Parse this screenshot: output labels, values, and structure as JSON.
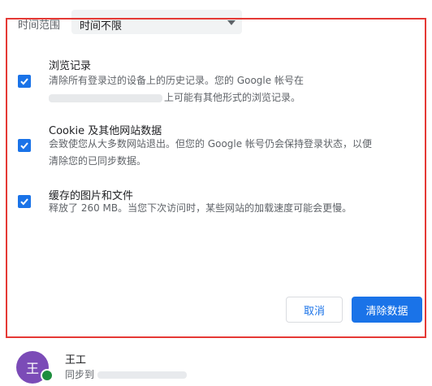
{
  "time_range": {
    "label": "时间范围",
    "selected": "时间不限"
  },
  "items": [
    {
      "title": "浏览记录",
      "desc_line1": "清除所有登录过的设备上的历史记录。您的 Google 帐号在",
      "desc_line2": "上可能有其他形式的浏览记录。",
      "checked": true
    },
    {
      "title": "Cookie 及其他网站数据",
      "desc_line1": "会致使您从大多数网站退出。但您的 Google 帐号仍会保持登录状态，以便",
      "desc_line2": "清除您的已同步数据。",
      "checked": true
    },
    {
      "title": "缓存的图片和文件",
      "desc_line1": "释放了 260 MB。当您下次访问时，某些网站的加载速度可能会更慢。",
      "checked": true
    }
  ],
  "buttons": {
    "cancel": "取消",
    "clear": "清除数据"
  },
  "account": {
    "avatar_letter": "王",
    "name": "王工",
    "sync_prefix": "同步到"
  },
  "colors": {
    "accent": "#1a73e8",
    "highlight_frame": "#e53935",
    "avatar": "#7b4bb7",
    "sync_badge": "#1e8e3e"
  }
}
